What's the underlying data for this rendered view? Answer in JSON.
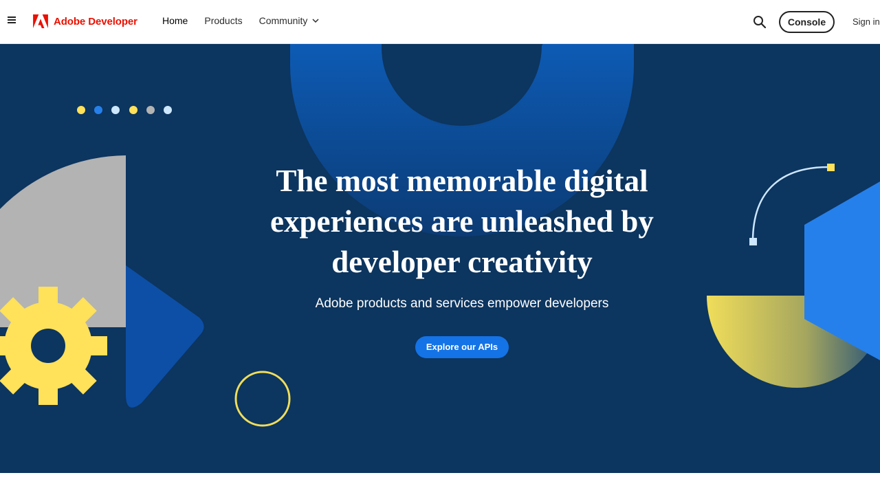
{
  "brand": {
    "name": "Adobe Developer",
    "color": "#eb1000"
  },
  "nav": {
    "items": [
      {
        "label": "Home",
        "active": true
      },
      {
        "label": "Products",
        "active": false
      },
      {
        "label": "Community",
        "active": false,
        "has_dropdown": true
      }
    ]
  },
  "header_actions": {
    "menu_icon": "hamburger-menu-icon",
    "search_icon": "search-icon",
    "console_label": "Console",
    "signin_label": "Sign in"
  },
  "hero": {
    "title": "The most memorable digital experiences are unleashed by developer creativity",
    "subtitle": "Adobe products and services empower developers",
    "cta_label": "Explore our APIs",
    "background_color": "#0c355f",
    "cta_color": "#1473e6"
  }
}
